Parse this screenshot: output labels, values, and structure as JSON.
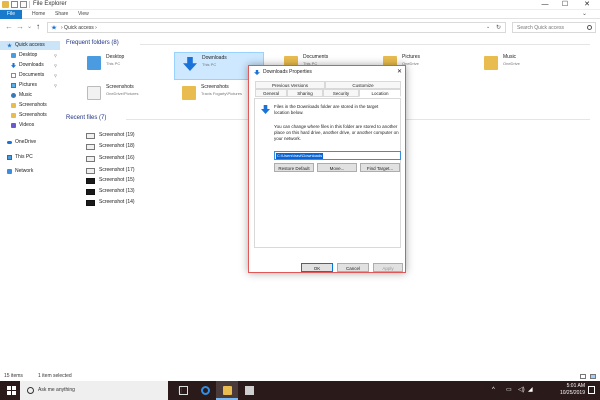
{
  "window": {
    "title": "This PC > Quick access",
    "title_text": "File Explorer",
    "min_glyph": "—",
    "max_glyph": "☐",
    "close_glyph": "✕"
  },
  "ribbon": {
    "tabs": [
      "File",
      "Home",
      "Share",
      "View"
    ],
    "expand_glyph": "⌄"
  },
  "address": {
    "back_glyph": "←",
    "forward_glyph": "→",
    "recent_glyph": "⌄",
    "up_glyph": "↑",
    "path": "› Quick access ›",
    "dropdown_glyph": "⌄",
    "refresh_glyph": "↻",
    "search_placeholder": "Search Quick access"
  },
  "nav": {
    "items": [
      {
        "label": "Quick access",
        "icon": "star-icon",
        "pinned": false
      },
      {
        "label": "Desktop",
        "icon": "desktop-icon",
        "pinned": true
      },
      {
        "label": "Downloads",
        "icon": "download-icon",
        "pinned": true
      },
      {
        "label": "Documents",
        "icon": "documents-icon",
        "pinned": true
      },
      {
        "label": "Pictures",
        "icon": "pictures-icon",
        "pinned": true
      },
      {
        "label": "Music",
        "icon": "music-icon",
        "pinned": false
      },
      {
        "label": "Screenshots",
        "icon": "folder-icon",
        "pinned": false
      },
      {
        "label": "Screenshots",
        "icon": "folder-icon",
        "pinned": false
      },
      {
        "label": "Videos",
        "icon": "videos-icon",
        "pinned": false
      },
      {
        "label": "OneDrive",
        "icon": "onedrive-icon",
        "pinned": false
      },
      {
        "label": "This PC",
        "icon": "this-pc-icon",
        "pinned": false
      },
      {
        "label": "Network",
        "icon": "network-icon",
        "pinned": false
      }
    ],
    "pin_glyph": "⚲"
  },
  "main": {
    "frequent_heading": "Frequent folders (8)",
    "recent_heading": "Recent files (7)",
    "folders": [
      {
        "name": "Desktop",
        "location": "This PC",
        "icon": "desktop-folder-icon",
        "selected": false
      },
      {
        "name": "Downloads",
        "location": "This PC",
        "icon": "downloads-folder-icon",
        "selected": true
      },
      {
        "name": "Documents",
        "location": "This PC",
        "icon": "documents-folder-icon",
        "selected": false
      },
      {
        "name": "Pictures",
        "location": "OneDrive",
        "icon": "pictures-folder-icon",
        "selected": false
      },
      {
        "name": "Music",
        "location": "OneDrive",
        "icon": "music-folder-icon",
        "selected": false
      },
      {
        "name": "Screenshots",
        "location": "OneDrive\\Pictures",
        "icon": "screenshots-folder-icon",
        "selected": false
      },
      {
        "name": "Screenshots",
        "location": "Travis Fogarty\\Pictures",
        "icon": "screenshots-folder-icon",
        "selected": false
      }
    ],
    "files": [
      {
        "name": "Screenshot (19)",
        "dark": false
      },
      {
        "name": "Screenshot (18)",
        "dark": false
      },
      {
        "name": "Screenshot (16)",
        "dark": false
      },
      {
        "name": "Screenshot (17)",
        "dark": false
      },
      {
        "name": "Screenshot (15)",
        "dark": true
      },
      {
        "name": "Screenshot (13)",
        "dark": true
      },
      {
        "name": "Screenshot (14)",
        "dark": true
      }
    ]
  },
  "status": {
    "item_count": "15 items",
    "selection": "1 item selected"
  },
  "dialog": {
    "title": "Downloads Properties",
    "close_glyph": "✕",
    "tabs_row1": [
      "Previous Versions",
      "Customize"
    ],
    "tabs_row2": [
      "General",
      "Sharing",
      "Security",
      "Location"
    ],
    "info": "Files in the Downloads folder are stored in the target location below.",
    "description": "You can change where files in this folder are stored to another place on this hard drive, another drive, or another computer on your network.",
    "path": "C:\\Users\\travi\\Downloads",
    "restore_label": "Restore Default",
    "move_label": "Move...",
    "find_label": "Find Target...",
    "ok_label": "OK",
    "cancel_label": "Cancel",
    "apply_label": "Apply"
  },
  "taskbar": {
    "search_text": "Ask me anything",
    "up_glyph": "^",
    "clock_time": "5:01 AM",
    "clock_date": "10/25/2019"
  },
  "colors": {
    "accent": "#1979ca",
    "selection": "#cde8ff",
    "dialog_border": "#e05858",
    "taskbar": "#2b1a1a"
  }
}
